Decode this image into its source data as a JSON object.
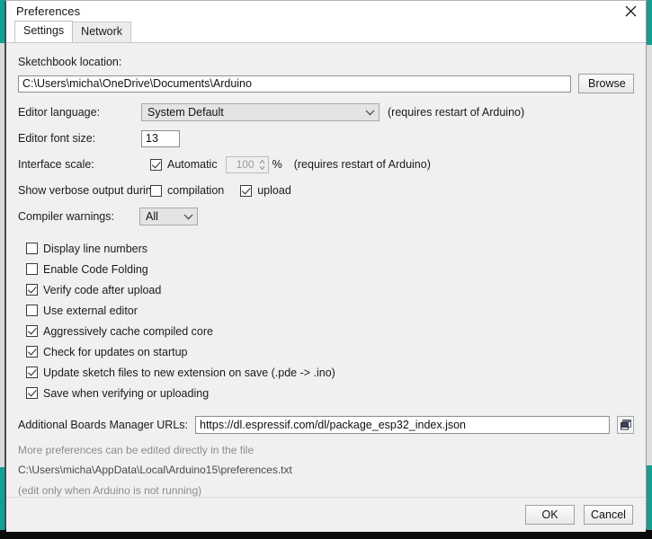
{
  "window": {
    "title": "Preferences",
    "close_icon": "close-icon"
  },
  "tabs": [
    {
      "label": "Settings",
      "active": true
    },
    {
      "label": "Network",
      "active": false
    }
  ],
  "settings": {
    "sketchbook": {
      "label": "Sketchbook location:",
      "value": "C:\\Users\\micha\\OneDrive\\Documents\\Arduino",
      "browse_label": "Browse"
    },
    "editor_language": {
      "label": "Editor language:",
      "value": "System Default",
      "note": "(requires restart of Arduino)",
      "chevron_icon": "chevron-down-icon"
    },
    "editor_font_size": {
      "label": "Editor font size:",
      "value": "13"
    },
    "interface_scale": {
      "label": "Interface scale:",
      "automatic_label": "Automatic",
      "automatic_checked": true,
      "scale_value": "100",
      "percent_label": "%",
      "note": "(requires restart of Arduino)",
      "spinner_icon": "spinner-arrows-icon"
    },
    "verbose_output": {
      "label": "Show verbose output during:",
      "options": [
        {
          "label": "compilation",
          "checked": false
        },
        {
          "label": "upload",
          "checked": true
        }
      ]
    },
    "compiler_warnings": {
      "label": "Compiler warnings:",
      "value": "All",
      "chevron_icon": "chevron-down-icon"
    },
    "checkboxes": [
      {
        "label": "Display line numbers",
        "checked": false
      },
      {
        "label": "Enable Code Folding",
        "checked": false
      },
      {
        "label": "Verify code after upload",
        "checked": true
      },
      {
        "label": "Use external editor",
        "checked": false
      },
      {
        "label": "Aggressively cache compiled core",
        "checked": true
      },
      {
        "label": "Check for updates on startup",
        "checked": true
      },
      {
        "label": "Update sketch files to new extension on save (.pde -> .ino)",
        "checked": true
      },
      {
        "label": "Save when verifying or uploading",
        "checked": true
      }
    ],
    "boards_urls": {
      "label": "Additional Boards Manager URLs:",
      "value": "https://dl.espressif.com/dl/package_esp32_index.json",
      "open_icon": "window-stack-icon"
    },
    "footnotes": {
      "line1": "More preferences can be edited directly in the file",
      "line2": "C:\\Users\\micha\\AppData\\Local\\Arduino15\\preferences.txt",
      "line3": "(edit only when Arduino is not running)"
    }
  },
  "footer": {
    "ok_label": "OK",
    "cancel_label": "Cancel"
  },
  "colors": {
    "accent_teal": "#12a094",
    "dialog_bg": "#f0f0f0",
    "text": "#1a1a1a",
    "muted_text": "#8d8d8d"
  }
}
